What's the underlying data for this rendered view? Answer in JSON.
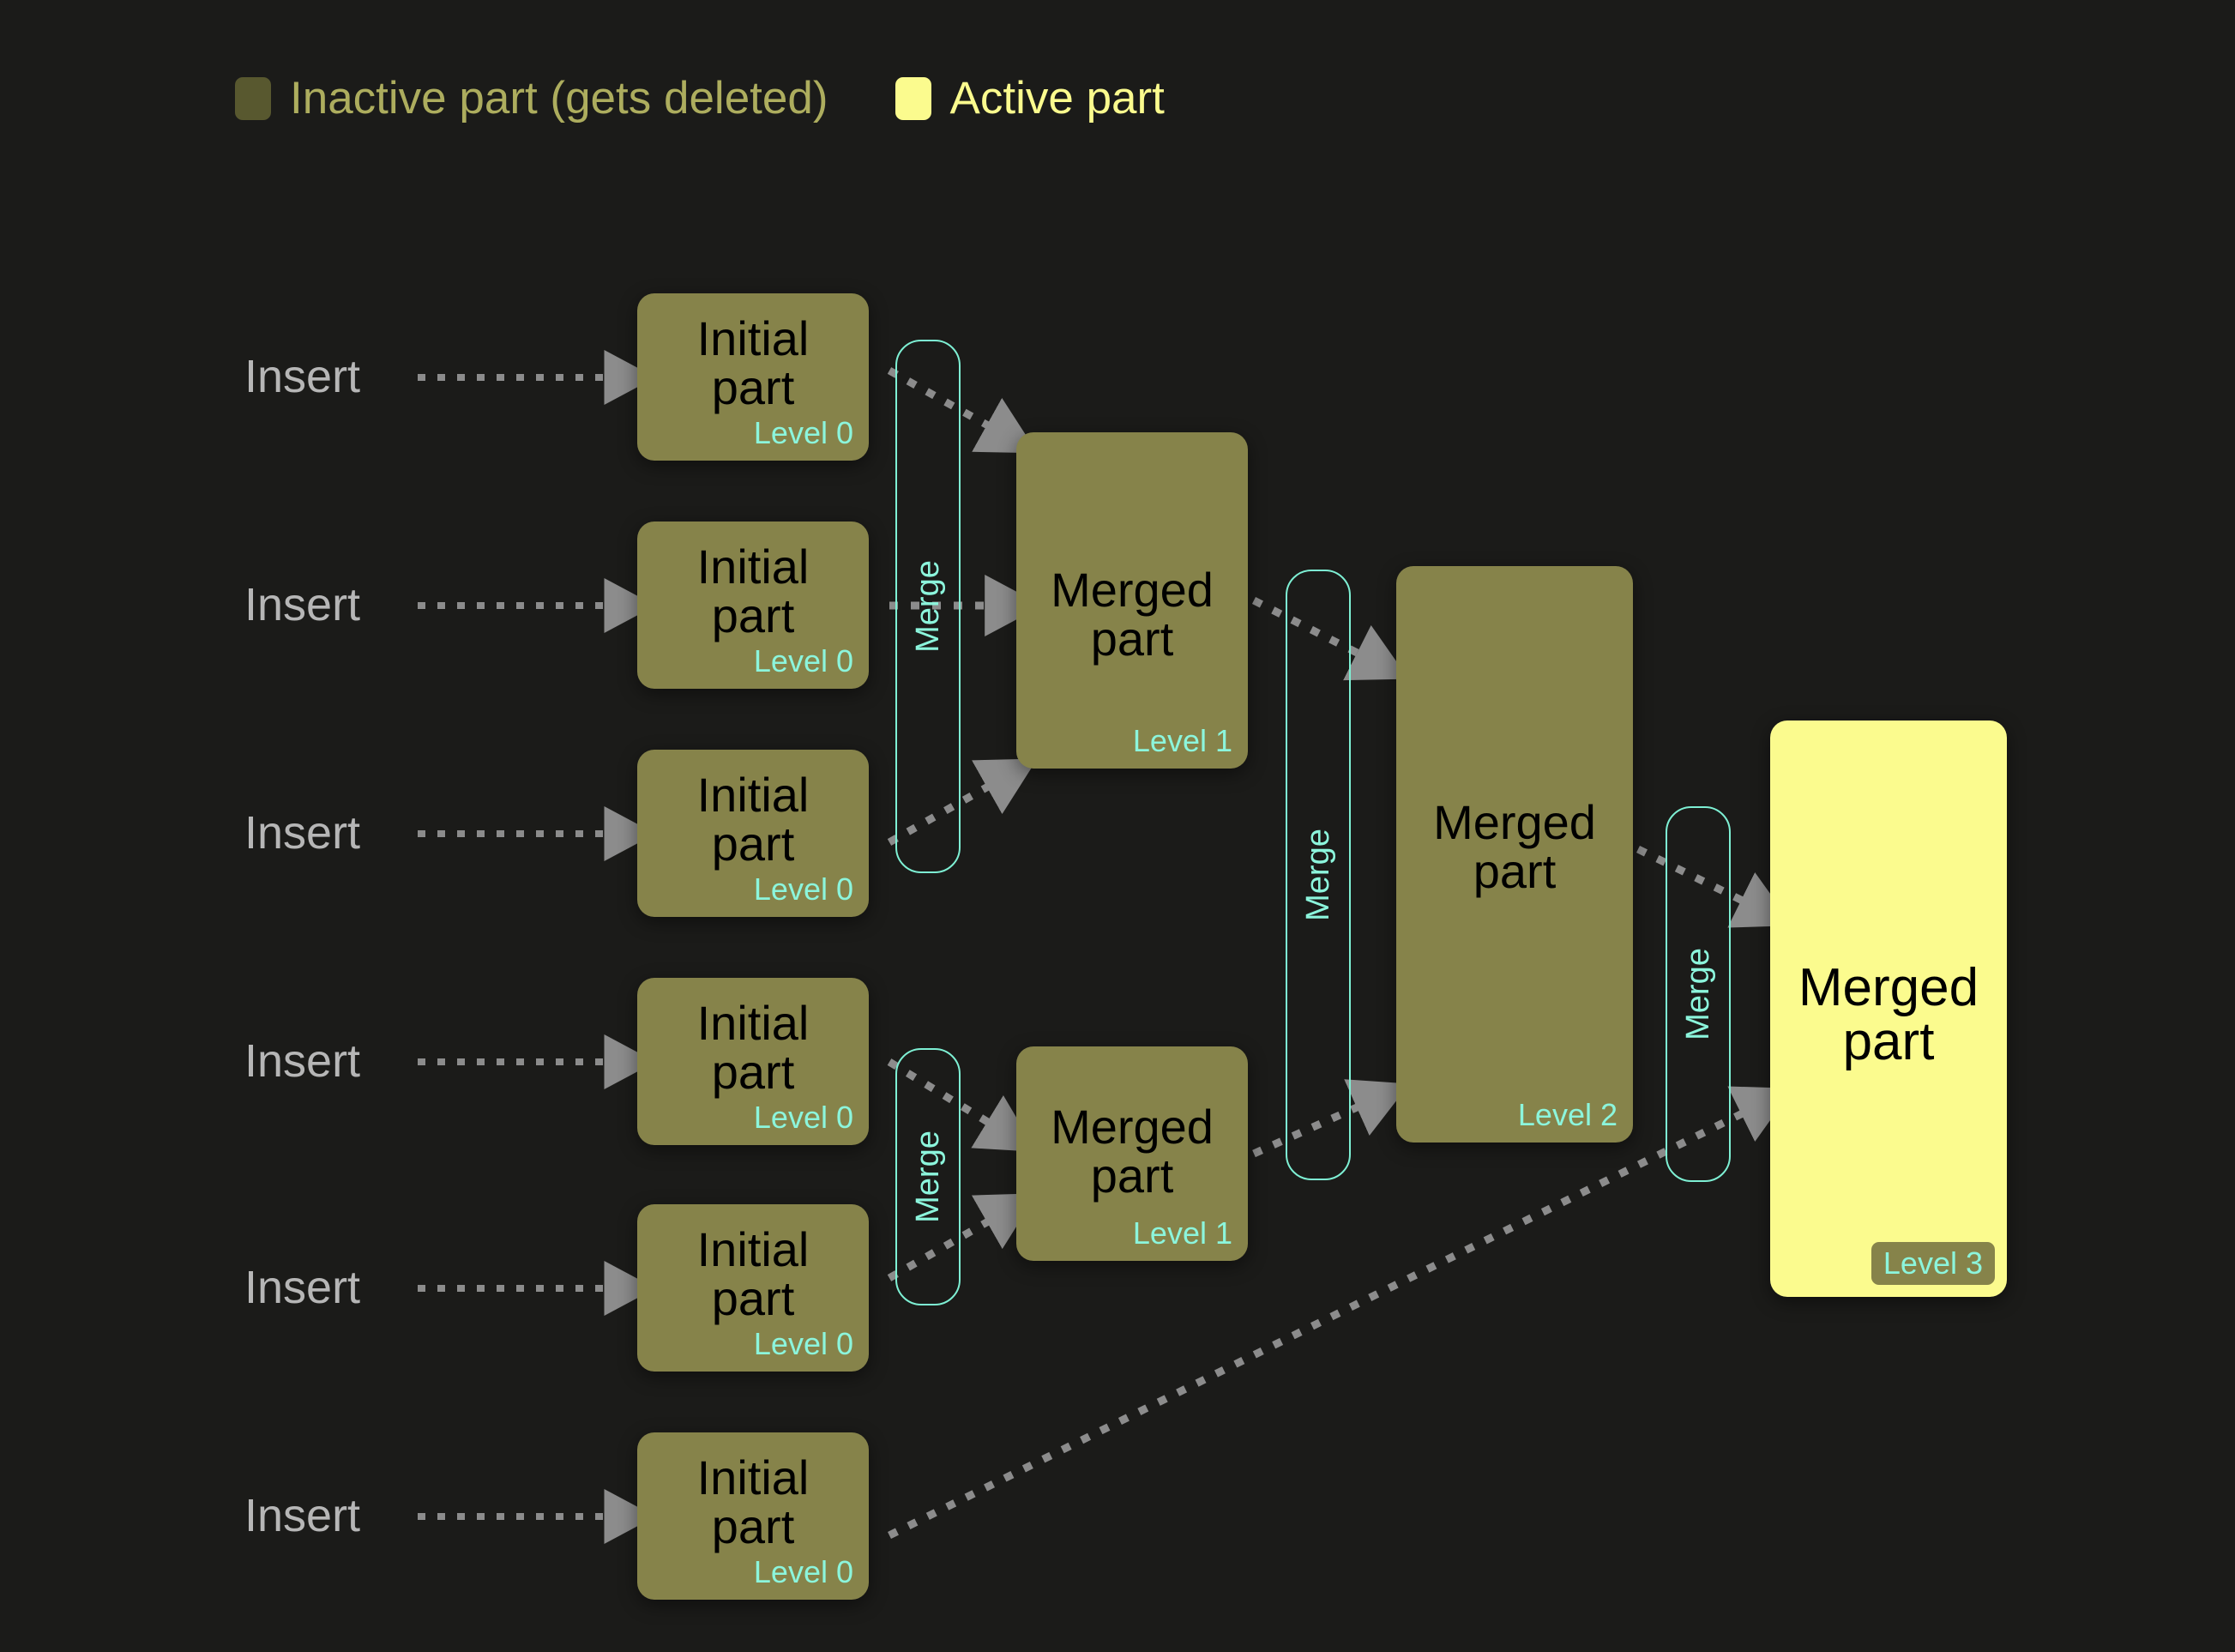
{
  "title": "MergeTree part merge lifecycle diagram",
  "theme": {
    "background": "#1b1b19",
    "inactive_fill": "#86834a",
    "active_fill": "#fbfb8e",
    "level_text": "#8cf5dc",
    "merge_border": "#7ef0d4",
    "arrow": "#8c8c8c",
    "insert_text": "#b6b6b6",
    "legend_inactive_text": "#adad5e",
    "legend_active_text": "#fbfb8e",
    "node_text": "#000000"
  },
  "legend": {
    "inactive": {
      "label": "Inactive part (gets deleted)",
      "swatch_color": "#58582f",
      "swatch_icon": "legend-swatch-icon"
    },
    "active": {
      "label": "Active part",
      "swatch_color": "#fbfb8e",
      "swatch_icon": "legend-swatch-icon"
    }
  },
  "insert_labels": [
    {
      "text": "Insert"
    },
    {
      "text": "Insert"
    },
    {
      "text": "Insert"
    },
    {
      "text": "Insert"
    },
    {
      "text": "Insert"
    },
    {
      "text": "Insert"
    }
  ],
  "initial_parts": [
    {
      "title": "Initial\npart",
      "level": "Level 0",
      "state": "inactive"
    },
    {
      "title": "Initial\npart",
      "level": "Level 0",
      "state": "inactive"
    },
    {
      "title": "Initial\npart",
      "level": "Level 0",
      "state": "inactive"
    },
    {
      "title": "Initial\npart",
      "level": "Level 0",
      "state": "inactive"
    },
    {
      "title": "Initial\npart",
      "level": "Level 0",
      "state": "inactive"
    },
    {
      "title": "Initial\npart",
      "level": "Level 0",
      "state": "inactive"
    }
  ],
  "merged_parts": [
    {
      "title": "Merged\npart",
      "level": "Level 1",
      "state": "inactive"
    },
    {
      "title": "Merged\npart",
      "level": "Level 1",
      "state": "inactive"
    },
    {
      "title": "Merged\npart",
      "level": "Level 2",
      "state": "inactive"
    },
    {
      "title": "Merged\npart",
      "level": "Level 3",
      "state": "active"
    }
  ],
  "merge_connectors": [
    {
      "label": "Merge"
    },
    {
      "label": "Merge"
    },
    {
      "label": "Merge"
    },
    {
      "label": "Merge"
    }
  ],
  "chart_data": {
    "type": "diagram",
    "title": "MergeTree part merge lifecycle",
    "levels": [
      0,
      1,
      2,
      3
    ],
    "nodes": [
      {
        "id": "i1",
        "label": "Initial part",
        "level": 0,
        "state": "inactive"
      },
      {
        "id": "i2",
        "label": "Initial part",
        "level": 0,
        "state": "inactive"
      },
      {
        "id": "i3",
        "label": "Initial part",
        "level": 0,
        "state": "inactive"
      },
      {
        "id": "i4",
        "label": "Initial part",
        "level": 0,
        "state": "inactive"
      },
      {
        "id": "i5",
        "label": "Initial part",
        "level": 0,
        "state": "inactive"
      },
      {
        "id": "i6",
        "label": "Initial part",
        "level": 0,
        "state": "inactive"
      },
      {
        "id": "m1",
        "label": "Merged part",
        "level": 1,
        "state": "inactive"
      },
      {
        "id": "m2",
        "label": "Merged part",
        "level": 1,
        "state": "inactive"
      },
      {
        "id": "m3",
        "label": "Merged part",
        "level": 2,
        "state": "inactive"
      },
      {
        "id": "m4",
        "label": "Merged part",
        "level": 3,
        "state": "active"
      }
    ],
    "edges": [
      {
        "from": "insert",
        "to": "i1",
        "label": "Insert"
      },
      {
        "from": "insert",
        "to": "i2",
        "label": "Insert"
      },
      {
        "from": "insert",
        "to": "i3",
        "label": "Insert"
      },
      {
        "from": "insert",
        "to": "i4",
        "label": "Insert"
      },
      {
        "from": "insert",
        "to": "i5",
        "label": "Insert"
      },
      {
        "from": "insert",
        "to": "i6",
        "label": "Insert"
      },
      {
        "from": "i1",
        "to": "m1",
        "label": "Merge"
      },
      {
        "from": "i2",
        "to": "m1",
        "label": "Merge"
      },
      {
        "from": "i3",
        "to": "m1",
        "label": "Merge"
      },
      {
        "from": "i4",
        "to": "m2",
        "label": "Merge"
      },
      {
        "from": "i5",
        "to": "m2",
        "label": "Merge"
      },
      {
        "from": "m1",
        "to": "m3",
        "label": "Merge"
      },
      {
        "from": "m2",
        "to": "m3",
        "label": "Merge"
      },
      {
        "from": "m3",
        "to": "m4",
        "label": "Merge"
      },
      {
        "from": "i6",
        "to": "m4",
        "label": "Merge"
      }
    ]
  }
}
